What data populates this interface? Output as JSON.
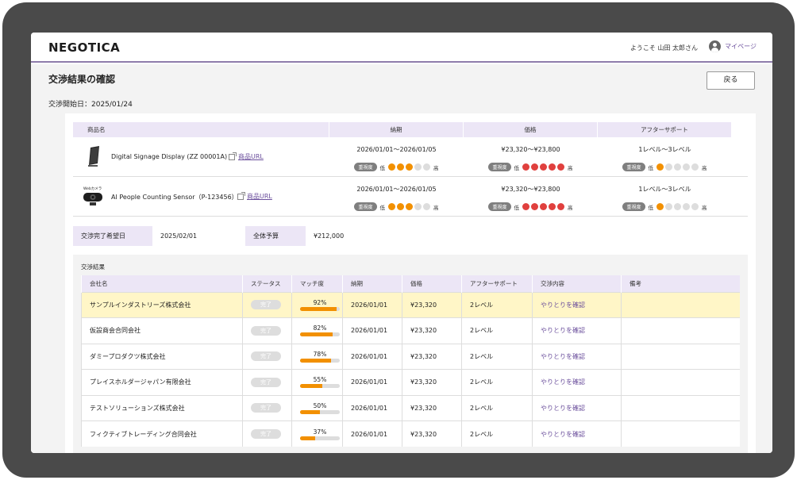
{
  "header": {
    "logo": "NEGOTICA",
    "welcome": "ようこそ 山田 太郎さん",
    "mypage": "マイページ"
  },
  "page": {
    "title": "交渉結果の確認",
    "back_label": "戻る",
    "start_date": "交渉開始日：2025/01/24"
  },
  "products": {
    "headers": [
      "商品名",
      "納期",
      "価格",
      "アフターサポート"
    ],
    "importance_label": "重視度",
    "low": "低",
    "high": "高",
    "rows": [
      {
        "name": "Digital Signage Display (ZZ 00001A)",
        "link": "商品URL",
        "delivery": "2026/01/01〜2026/01/05",
        "delivery_importance": 3,
        "price": "¥23,320〜¥23,800",
        "price_importance": 5,
        "support": "1レベル〜3レベル",
        "support_importance": 1,
        "image_caption": ""
      },
      {
        "name": "AI People Counting Sensor（P-123456）",
        "link": "商品URL",
        "delivery": "2026/01/01〜2026/01/05",
        "delivery_importance": 3,
        "price": "¥23,320〜¥23,800",
        "price_importance": 5,
        "support": "1レベル〜3レベル",
        "support_importance": 1,
        "image_caption": "Webカメラ"
      }
    ]
  },
  "conditions": {
    "deadline_label": "交渉完了希望日",
    "deadline_value": "2025/02/01",
    "budget_label": "全体予算",
    "budget_value": "¥212,000"
  },
  "results": {
    "title": "交渉結果",
    "headers": [
      "会社名",
      "ステータス",
      "マッチ度",
      "納期",
      "価格",
      "アフターサポート",
      "交渉内容",
      "備考"
    ],
    "rows": [
      {
        "company": "サンプルインダストリーズ株式会社",
        "status": "完了",
        "match": "92%",
        "match_value": 92,
        "delivery": "2026/01/01",
        "price": "¥23,320",
        "support": "2レベル",
        "link": "やりとりを確認",
        "note": "",
        "highlight": true
      },
      {
        "company": "仮設商会合同会社",
        "status": "完了",
        "match": "82%",
        "match_value": 82,
        "delivery": "2026/01/01",
        "price": "¥23,320",
        "support": "2レベル",
        "link": "やりとりを確認",
        "note": "",
        "highlight": false
      },
      {
        "company": "ダミープロダクツ株式会社",
        "status": "完了",
        "match": "78%",
        "match_value": 78,
        "delivery": "2026/01/01",
        "price": "¥23,320",
        "support": "2レベル",
        "link": "やりとりを確認",
        "note": "",
        "highlight": false
      },
      {
        "company": "プレイスホルダージャパン有限会社",
        "status": "完了",
        "match": "55%",
        "match_value": 55,
        "delivery": "2026/01/01",
        "price": "¥23,320",
        "support": "2レベル",
        "link": "やりとりを確認",
        "note": "",
        "highlight": false
      },
      {
        "company": "テストソリューションズ株式会社",
        "status": "完了",
        "match": "50%",
        "match_value": 50,
        "delivery": "2026/01/01",
        "price": "¥23,320",
        "support": "2レベル",
        "link": "やりとりを確認",
        "note": "",
        "highlight": false
      },
      {
        "company": "フィクティブトレーディング合同会社",
        "status": "完了",
        "match": "37%",
        "match_value": 37,
        "delivery": "2026/01/01",
        "price": "¥23,320",
        "support": "2レベル",
        "link": "やりとりを確認",
        "note": "",
        "highlight": false
      }
    ]
  },
  "colors": {
    "accent": "#6b4f9c",
    "header_bg": "#ece6f6",
    "importance_orange": "#f29000",
    "importance_red": "#e0403e",
    "highlight_row": "#fff6c7"
  }
}
